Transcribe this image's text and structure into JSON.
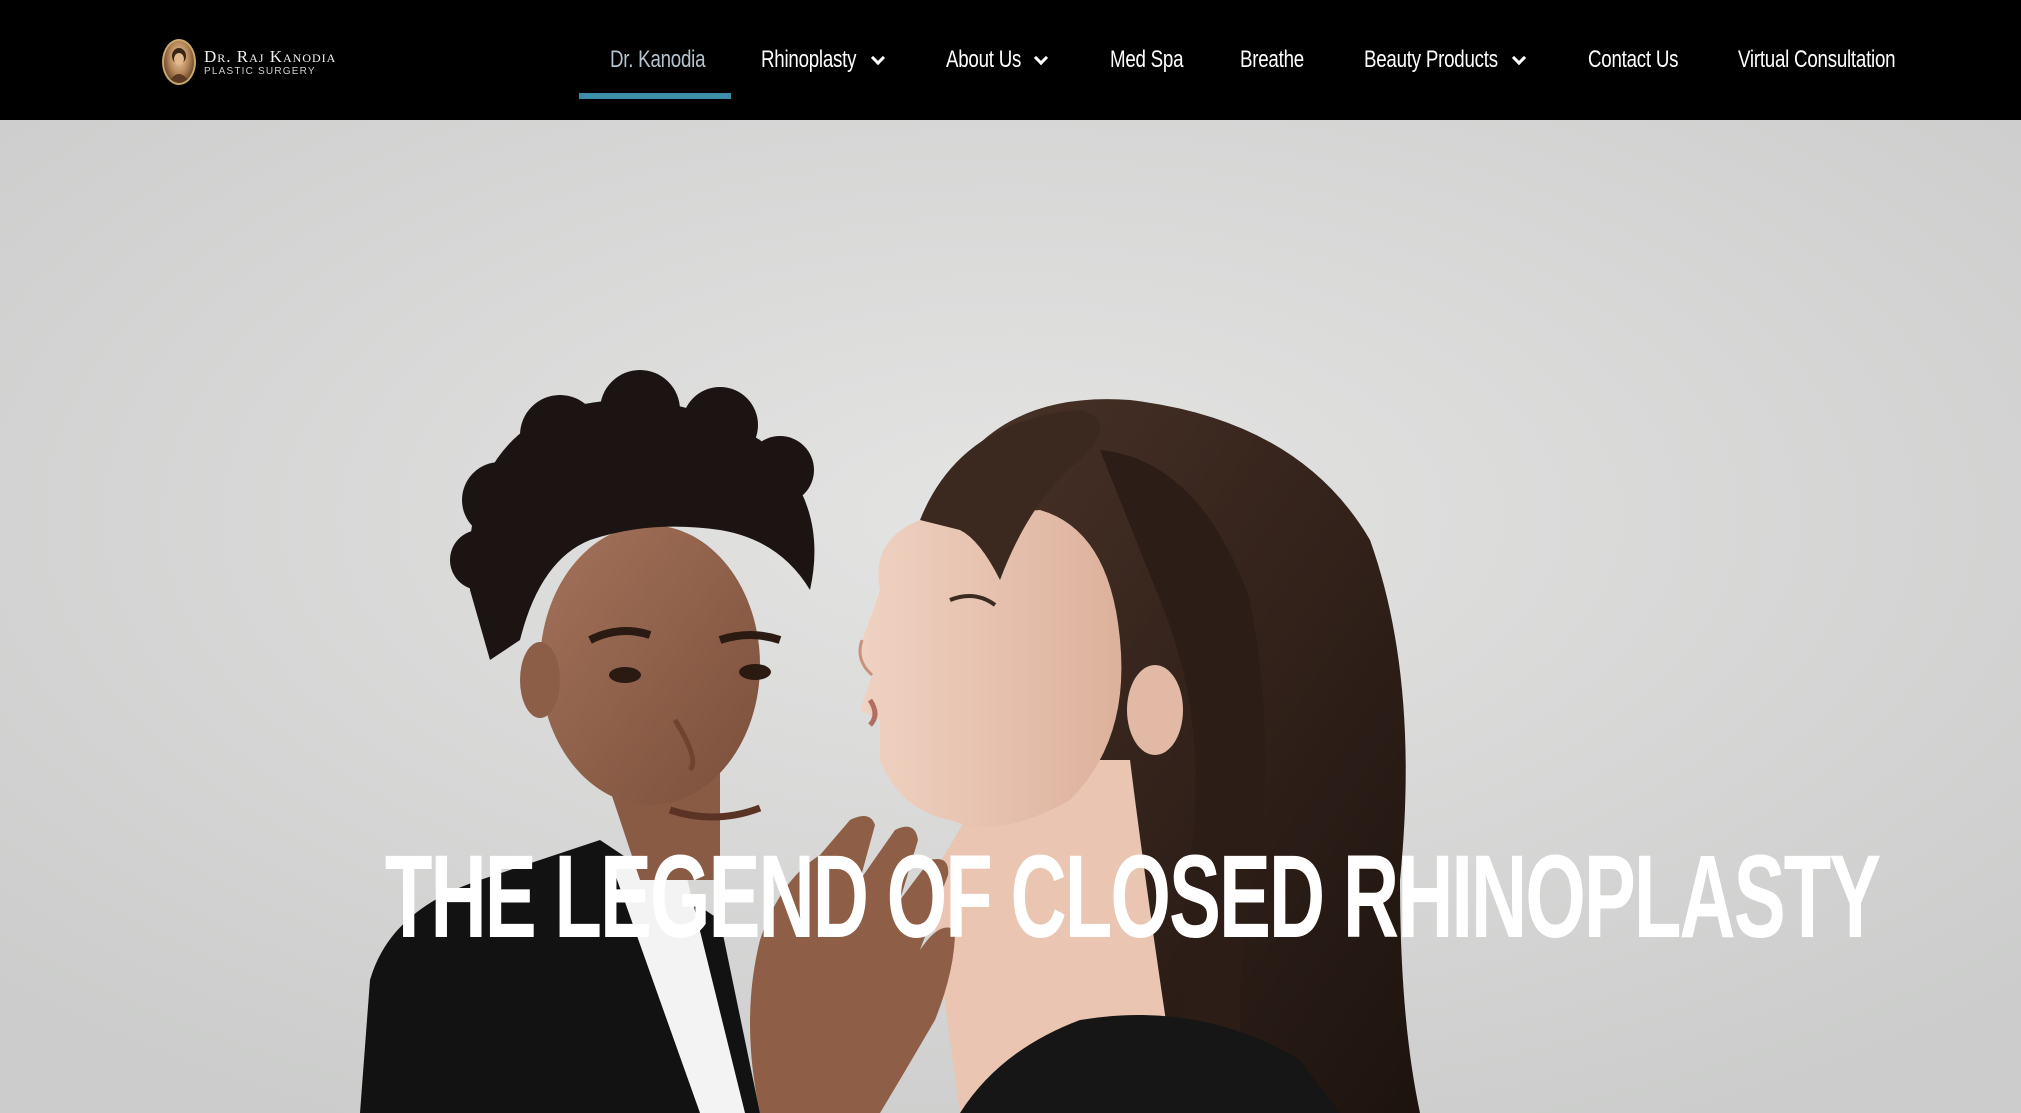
{
  "logo": {
    "name": "Dr. Raj Kanodia",
    "subtitle": "PLASTIC SURGERY",
    "icon": "portrait-medallion-icon"
  },
  "nav": {
    "items": [
      {
        "label": "Dr. Kanodia",
        "active": true,
        "dropdown": false
      },
      {
        "label": "Rhinoplasty",
        "active": false,
        "dropdown": true
      },
      {
        "label": "About Us",
        "active": false,
        "dropdown": true
      },
      {
        "label": "Med Spa",
        "active": false,
        "dropdown": false
      },
      {
        "label": "Breathe",
        "active": false,
        "dropdown": false
      },
      {
        "label": "Beauty Products",
        "active": false,
        "dropdown": true
      },
      {
        "label": "Contact Us",
        "active": false,
        "dropdown": false
      },
      {
        "label": "Virtual Consultation",
        "active": false,
        "dropdown": false
      }
    ],
    "dropdown_icon": "chevron-down-icon"
  },
  "hero": {
    "heading": "THE LEGEND OF CLOSED RHINOPLASTY"
  },
  "colors": {
    "nav_background": "#000000",
    "active_underline": "#3d8ea8",
    "active_text": "#b4c3cc",
    "hero_background": "#d9d9d9"
  }
}
